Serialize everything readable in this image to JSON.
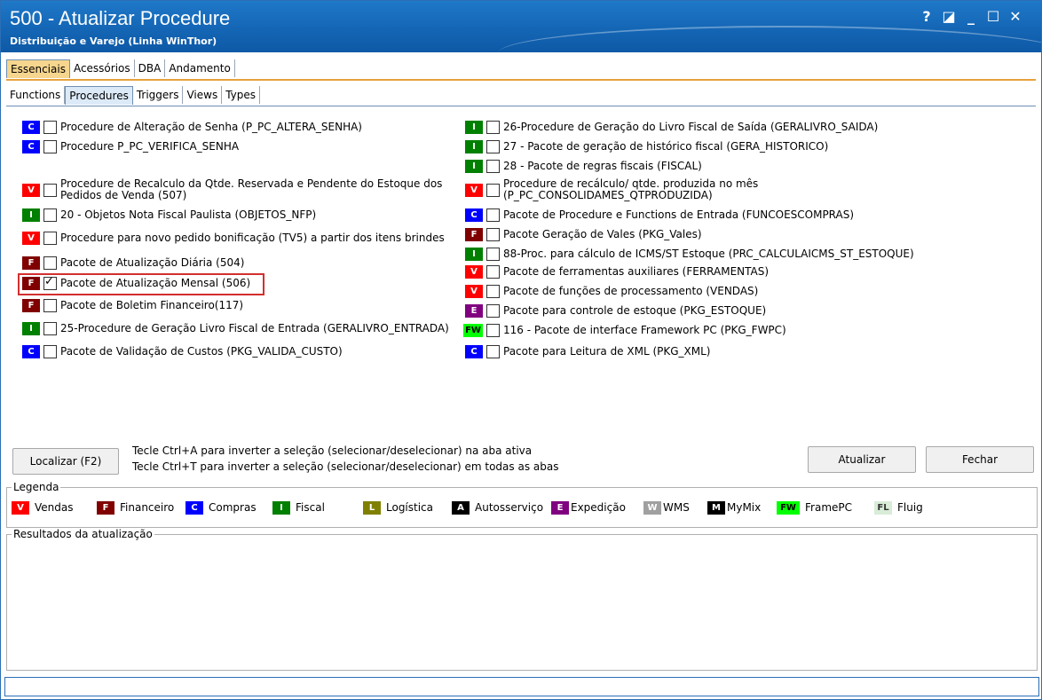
{
  "window": {
    "title": "500 - Atualizar Procedure",
    "subtitle": "Distribuição e Varejo (Linha WinThor)",
    "controls": {
      "help": "?",
      "restore": "◪",
      "minimize": "_",
      "maximize": "☐",
      "close": "✕"
    }
  },
  "tabs_main": [
    "Essenciais",
    "Acessórios",
    "DBA",
    "Andamento"
  ],
  "tabs_sub": [
    "Functions",
    "Procedures",
    "Triggers",
    "Views",
    "Types"
  ],
  "colors": {
    "vendas": "#ff0000",
    "financeiro": "#800000",
    "compras": "#0000ff",
    "fiscal": "#008000",
    "logistica": "#808000",
    "autosservico": "#000000",
    "expedicao": "#800080",
    "wms": "#a0a0a0",
    "mymix": "#000000",
    "framepc": "#00ff00",
    "fluig": "#d8ecd8"
  },
  "left_items": [
    {
      "badge": "C",
      "text": "Procedure de Alteração de Senha (P_PC_ALTERA_SENHA)",
      "checked": false
    },
    {
      "badge": "C",
      "text": "Procedure P_PC_VERIFICA_SENHA",
      "checked": false
    },
    {
      "badge": "V",
      "text": "Procedure de Recalculo da Qtde. Reservada e Pendente do Estoque dos",
      "text2": "Pedidos de Venda (507)",
      "checked": false
    },
    {
      "badge": "I",
      "text": "20 - Objetos Nota Fiscal Paulista (OBJETOS_NFP)",
      "checked": false
    },
    {
      "badge": "V",
      "text": "Procedure para novo pedido bonificação (TV5) a partir dos itens brindes",
      "checked": false
    },
    {
      "badge": "F",
      "text": "Pacote de Atualização Diária (504)",
      "checked": false
    },
    {
      "badge": "F",
      "text": "Pacote de Atualização Mensal (506)",
      "checked": true
    },
    {
      "badge": "F",
      "text": "Pacote de Boletim Financeiro(117)",
      "checked": false
    },
    {
      "badge": "I",
      "text": "25-Procedure de Geração Livro Fiscal de Entrada (GERALIVRO_ENTRADA)",
      "checked": false
    },
    {
      "badge": "C",
      "text": "Pacote de Validação de Custos (PKG_VALIDA_CUSTO)",
      "checked": false
    }
  ],
  "right_items": [
    {
      "badge": "I",
      "text": "26-Procedure de Geração do Livro Fiscal de Saída (GERALIVRO_SAIDA)",
      "checked": false
    },
    {
      "badge": "I",
      "text": "27 - Pacote de geração de histórico fiscal (GERA_HISTORICO)",
      "checked": false
    },
    {
      "badge": "I",
      "text": "28 - Pacote de regras fiscais (FISCAL)",
      "checked": false
    },
    {
      "badge": "V",
      "text": "Procedure de recálculo/ qtde. produzida no mês",
      "text2": "(P_PC_CONSOLIDAMES_QTPRODUZIDA)",
      "checked": false
    },
    {
      "badge": "C",
      "text": "Pacote de Procedure e Functions de Entrada (FUNCOESCOMPRAS)",
      "checked": false
    },
    {
      "badge": "F",
      "text": "Pacote Geração de Vales (PKG_Vales)",
      "checked": false
    },
    {
      "badge": "I",
      "text": "88-Proc. para cálculo de ICMS/ST Estoque (PRC_CALCULAICMS_ST_ESTOQUE)",
      "checked": false
    },
    {
      "badge": "V",
      "text": "Pacote de ferramentas auxiliares (FERRAMENTAS)",
      "checked": false
    },
    {
      "badge": "V",
      "text": "Pacote de funções de processamento (VENDAS)",
      "checked": false
    },
    {
      "badge": "E",
      "text": "Pacote para controle de estoque (PKG_ESTOQUE)",
      "checked": false
    },
    {
      "badge": "FW",
      "text": "116 - Pacote de interface Framework PC (PKG_FWPC)",
      "checked": false
    },
    {
      "badge": "C",
      "text": "Pacote para Leitura de XML (PKG_XML)",
      "checked": false
    }
  ],
  "buttons": {
    "localizar": "Localizar (F2)",
    "atualizar": "Atualizar",
    "fechar": "Fechar"
  },
  "hints": [
    "Tecle Ctrl+A para inverter a seleção (selecionar/deselecionar) na aba ativa",
    "Tecle Ctrl+T para inverter a seleção (selecionar/deselecionar) em todas as abas"
  ],
  "legend": {
    "label": "Legenda",
    "items": [
      {
        "badge": "V",
        "label": "Vendas"
      },
      {
        "badge": "F",
        "label": "Financeiro"
      },
      {
        "badge": "C",
        "label": "Compras"
      },
      {
        "badge": "I",
        "label": "Fiscal"
      },
      {
        "badge": "L",
        "label": "Logística"
      },
      {
        "badge": "A",
        "label": "Autosserviço"
      },
      {
        "badge": "E",
        "label": "Expedição"
      },
      {
        "badge": "W",
        "label": "WMS"
      },
      {
        "badge": "M",
        "label": "MyMix"
      },
      {
        "badge": "FW",
        "label": "FramePC"
      },
      {
        "badge": "FL",
        "label": "Fluig"
      }
    ]
  },
  "results": {
    "label": "Resultados da atualização"
  }
}
